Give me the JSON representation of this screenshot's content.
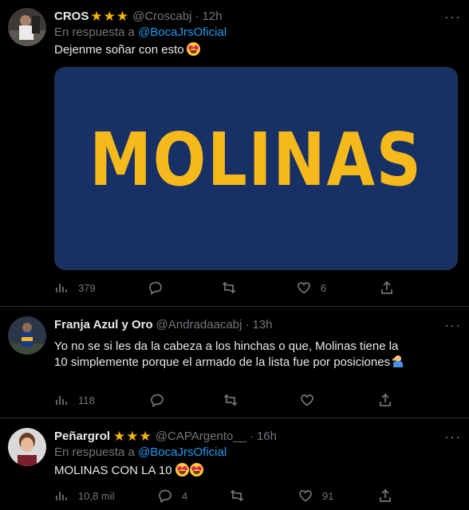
{
  "tweets": [
    {
      "name": "CROS",
      "stars": 3,
      "handle": "@Croscabj",
      "separator": "·",
      "time": "12h",
      "reply_prefix": "En respuesta a",
      "reply_to": "@BocaJrsOficial",
      "text": "Dejenme soñar con esto",
      "emoji": "heart-eyes",
      "media_text": "MOLINAS",
      "stats": {
        "views": "379",
        "replies": "",
        "retweets": "",
        "likes": "6"
      }
    },
    {
      "name": "Franja Azul y Oro",
      "stars": 0,
      "handle": "@Andradaacabj",
      "separator": "·",
      "time": "13h",
      "text": "Yo no se si les da la cabeza a los hinchas o que, Molinas tiene la 10 simplemente porque el armado de la lista fue por posiciones",
      "emoji": "man-facepalming",
      "stats": {
        "views": "118",
        "replies": "",
        "retweets": "",
        "likes": ""
      }
    },
    {
      "name": "Peñargrol",
      "stars": 3,
      "handle": "@CAPArgento__",
      "separator": "·",
      "time": "16h",
      "reply_prefix": "En respuesta a",
      "reply_to": "@BocaJrsOficial",
      "text": "MOLINAS CON LA 10",
      "emoji": "heart-eyes x2",
      "stats": {
        "views": "10,8 mil",
        "replies": "4",
        "retweets": "",
        "likes": "91"
      }
    }
  ],
  "colors": {
    "background": "#000000",
    "accent": "#1d9bf0",
    "muted": "#71767b",
    "star": "#f4b400",
    "media_bg": "#173066",
    "media_text": "#f6b91c"
  },
  "icons": {
    "more": "more-icon",
    "views": "views-icon",
    "reply": "reply-icon",
    "retweet": "retweet-icon",
    "like": "like-icon",
    "share": "share-icon"
  }
}
